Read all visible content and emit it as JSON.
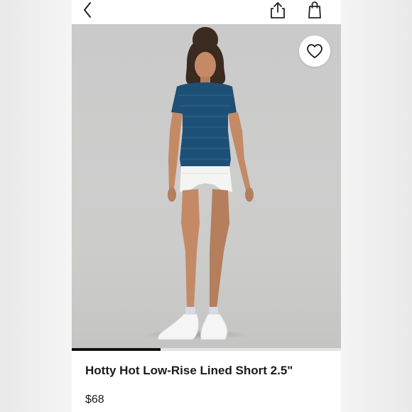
{
  "product": {
    "title": "Hotty Hot Low-Rise Lined Short 2.5\"",
    "price": "$68"
  },
  "toolbar": {
    "back_icon": "chevron-left-icon",
    "share_icon": "share-icon",
    "bag_icon": "shopping-bag-icon"
  },
  "gallery": {
    "wishlist_icon": "heart-icon",
    "progress_fraction": 0.33
  },
  "colors": {
    "accent": "#111111",
    "top": "#1e4f75",
    "shorts": "#f4f4f2",
    "background": "#cbcbca"
  }
}
